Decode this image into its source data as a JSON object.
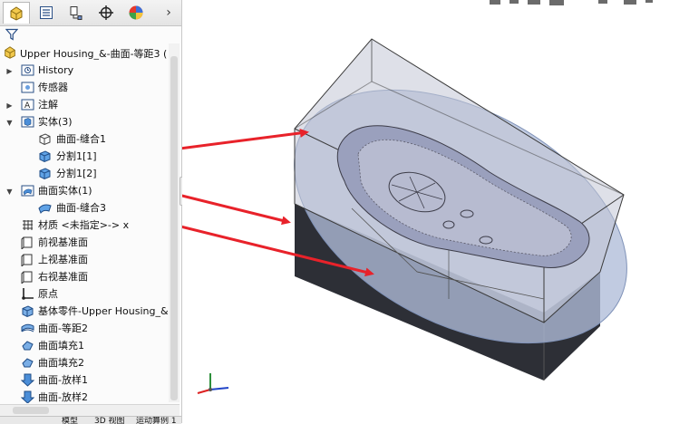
{
  "tabs": [
    {
      "name": "featuremanager-tab",
      "icon": "feature-manager-icon",
      "active": true
    },
    {
      "name": "propertymanager-tab",
      "icon": "property-manager-icon",
      "active": false
    },
    {
      "name": "configurationmanager-tab",
      "icon": "configuration-manager-icon",
      "active": false
    },
    {
      "name": "dimxpert-tab",
      "icon": "dimxpert-crosshair-icon",
      "active": false
    },
    {
      "name": "display-manager-tab",
      "icon": "appearance-sphere-icon",
      "active": false
    },
    {
      "name": "more-tabs",
      "icon": "chevron-right-icon",
      "label": "›"
    }
  ],
  "filter": {
    "icon": "filter-funnel-icon"
  },
  "tree": {
    "root_label": "Upper Housing_&-曲面-等距3  (",
    "items": [
      {
        "label": "History",
        "icon": "history-icon"
      },
      {
        "label": "传感器",
        "icon": "sensors-icon"
      },
      {
        "label": "注解",
        "icon": "annotations-icon"
      },
      {
        "label": "实体(3)",
        "icon": "solid-bodies-folder-icon"
      },
      {
        "label": "曲面-缝合1",
        "icon": "wireframe-body-icon"
      },
      {
        "label": "分割1[1]",
        "icon": "solid-body-icon"
      },
      {
        "label": "分割1[2]",
        "icon": "solid-body-icon"
      },
      {
        "label": "曲面实体(1)",
        "icon": "surface-bodies-folder-icon"
      },
      {
        "label": "曲面-缝合3",
        "icon": "surface-body-icon"
      },
      {
        "label": "材质 <未指定>-> x",
        "icon": "material-icon"
      },
      {
        "label": "前视基准面",
        "icon": "plane-icon"
      },
      {
        "label": "上视基准面",
        "icon": "plane-icon"
      },
      {
        "label": "右视基准面",
        "icon": "plane-icon"
      },
      {
        "label": "原点",
        "icon": "origin-icon"
      },
      {
        "label": "基体零件-Upper Housing_&-",
        "icon": "base-part-icon"
      },
      {
        "label": "曲面-等距2",
        "icon": "offset-surface-icon"
      },
      {
        "label": "曲面填充1",
        "icon": "filled-surface-icon"
      },
      {
        "label": "曲面填充2",
        "icon": "filled-surface-icon"
      },
      {
        "label": "曲面-放样1",
        "icon": "lofted-surface-icon"
      },
      {
        "label": "曲面-放样2",
        "icon": "lofted-surface-icon"
      }
    ]
  },
  "bottom_tabs": [
    "模型",
    "3D 视图",
    "运动算例 1"
  ],
  "colors": {
    "arrow": "#e8222a",
    "model_face": "#a9aec8",
    "model_edge": "#3a3a3a",
    "surface_disc": "#b0bcd8"
  }
}
